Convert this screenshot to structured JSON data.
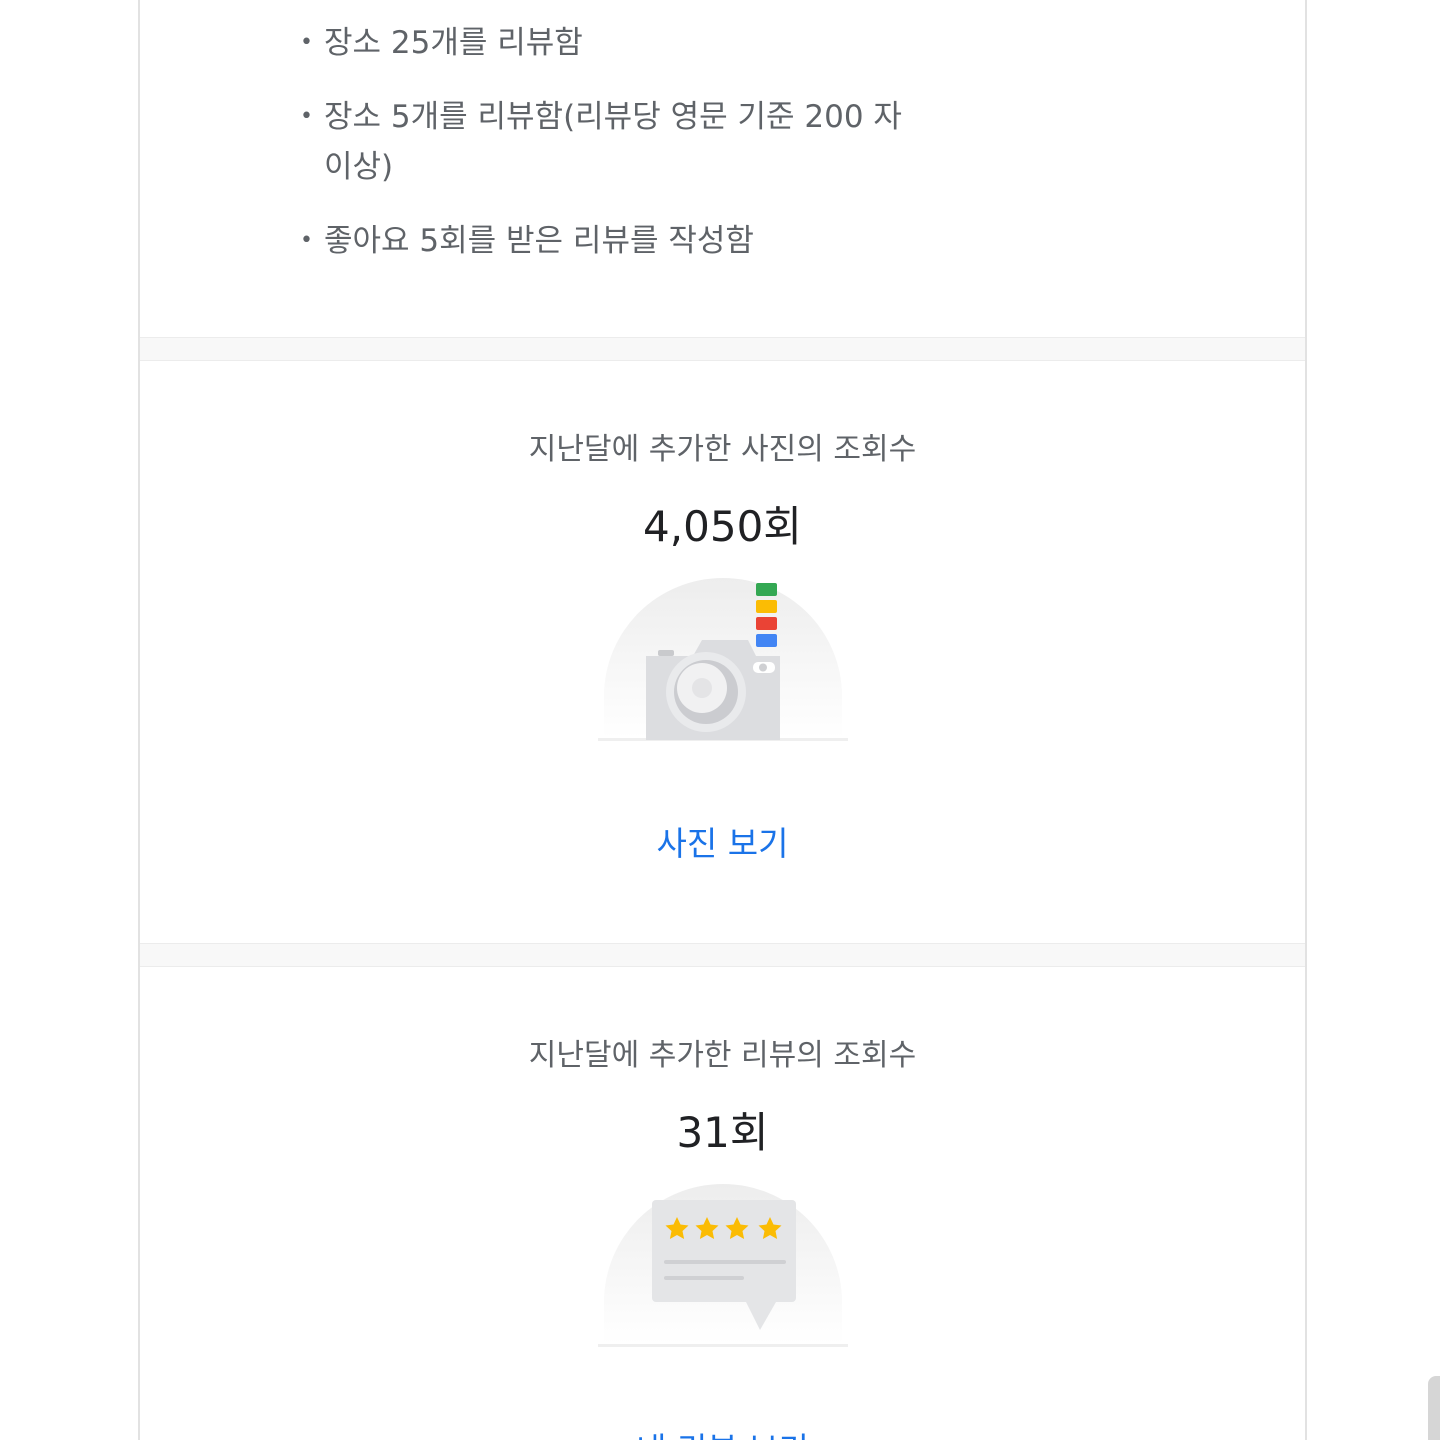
{
  "requirements": [
    "장소 25개를 리뷰함",
    "장소 5개를 리뷰함(리뷰당 영문 기준 200 자 이상)",
    "좋아요 5회를 받은 리뷰를 작성함"
  ],
  "photo_stats": {
    "label": "지난달에 추가한 사진의 조회수",
    "value": "4,050회",
    "link": "사진 보기",
    "illustration": "camera-icon"
  },
  "review_stats": {
    "label": "지난달에 추가한 리뷰의 조회수",
    "value": "31회",
    "link": "내 리뷰 보기",
    "illustration": "review-card-icon"
  },
  "colors": {
    "link": "#1a73e8",
    "google_green": "#34a853",
    "google_yellow": "#fbbc04",
    "google_red": "#ea4335",
    "google_blue": "#4285f4",
    "star": "#fbbc04"
  }
}
